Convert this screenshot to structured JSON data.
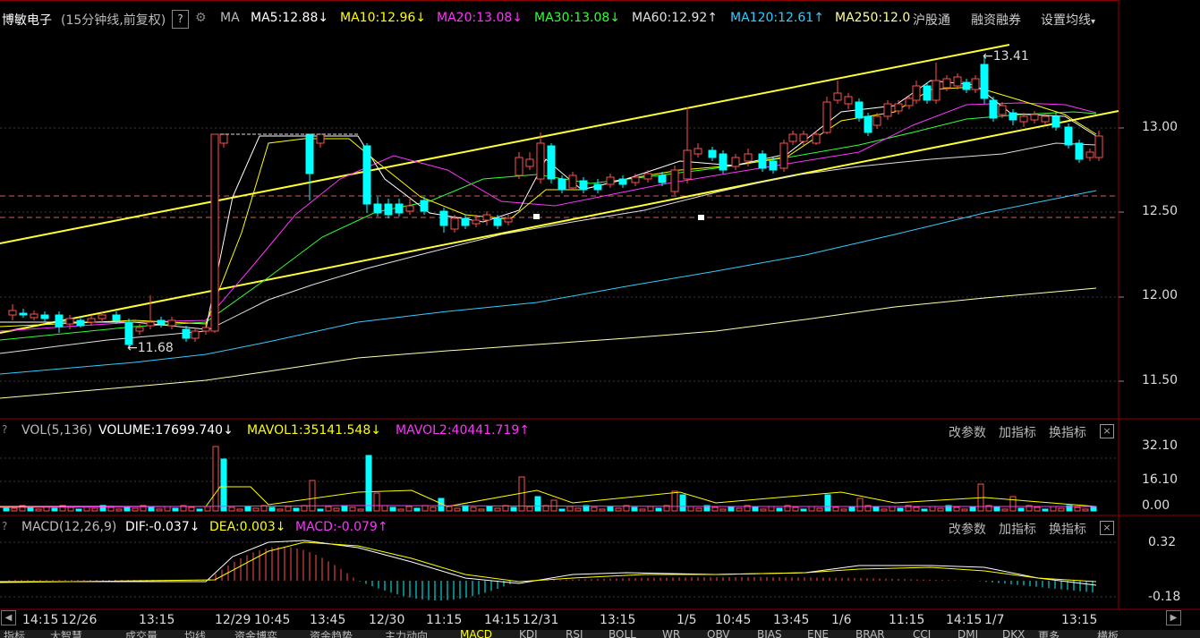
{
  "header": {
    "title": "博敏电子",
    "subtitle": "(15分钟线,前复权)",
    "help": "?",
    "ma_label": "MA",
    "indicators": [
      {
        "text": "MA5:12.88",
        "arrow": "↓",
        "color": "#ffffff"
      },
      {
        "text": "MA10:12.96",
        "arrow": "↓",
        "color": "#ffff00"
      },
      {
        "text": "MA20:13.08",
        "arrow": "↓",
        "color": "#ff33ff"
      },
      {
        "text": "MA30:13.08",
        "arrow": "↓",
        "color": "#33ff33"
      },
      {
        "text": "MA60:12.92",
        "arrow": "↑",
        "color": "#e0e0e0"
      },
      {
        "text": "MA120:12.61",
        "arrow": "↑",
        "color": "#33ccff"
      },
      {
        "text": "MA250:12.0",
        "arrow": "",
        "color": "#ffff99"
      }
    ],
    "links": [
      "沪股通",
      "融资融券",
      "设置均线"
    ]
  },
  "price_axis": [
    "13.00",
    "12.50",
    "12.00",
    "11.50"
  ],
  "annotations": {
    "high": "13.41",
    "low": "11.68"
  },
  "volume_panel": {
    "name": "VOL(5,136)",
    "volume": "VOLUME:17699.740",
    "volume_arrow": "↓",
    "mavol1": "MAVOL1:35141.548",
    "mavol1_arrow": "↓",
    "mavol2": "MAVOL2:40441.719",
    "mavol2_arrow": "↑",
    "axis": [
      "32.10",
      "16.10",
      "0.00"
    ],
    "buttons": [
      "改参数",
      "加指标",
      "换指标"
    ],
    "close": "×"
  },
  "macd_panel": {
    "name": "MACD(12,26,9)",
    "dif": "DIF:-0.037",
    "dif_arrow": "↓",
    "dea": "DEA:0.003",
    "dea_arrow": "↓",
    "macd": "MACD:-0.079",
    "macd_arrow": "↑",
    "axis": [
      "0.32",
      "-0.18"
    ],
    "buttons": [
      "改参数",
      "加指标",
      "换指标"
    ],
    "close": "×"
  },
  "time_axis": [
    "14:15",
    "12/26",
    "13:15",
    "12/29",
    "10:45",
    "13:45",
    "12/30",
    "11:15",
    "14:15",
    "12/31",
    "13:15",
    "1/5",
    "10:45",
    "13:45",
    "1/6",
    "11:15",
    "14:15",
    "1/7",
    "13:15"
  ],
  "bottom_tabs": [
    "指标",
    "大智慧",
    "成交量",
    "均线",
    "资金博弈",
    "资金趋势",
    "主力动向",
    "MACD",
    "KDJ",
    "RSI",
    "BOLL",
    "WR",
    "OBV",
    "BIAS",
    "ENE",
    "BRAR",
    "CCI",
    "DMI",
    "DKX",
    "更多",
    "横板"
  ],
  "colors": {
    "up": "#ff5050",
    "down": "#00ffff",
    "channel": "#ffff33",
    "bg": "#000000"
  }
}
